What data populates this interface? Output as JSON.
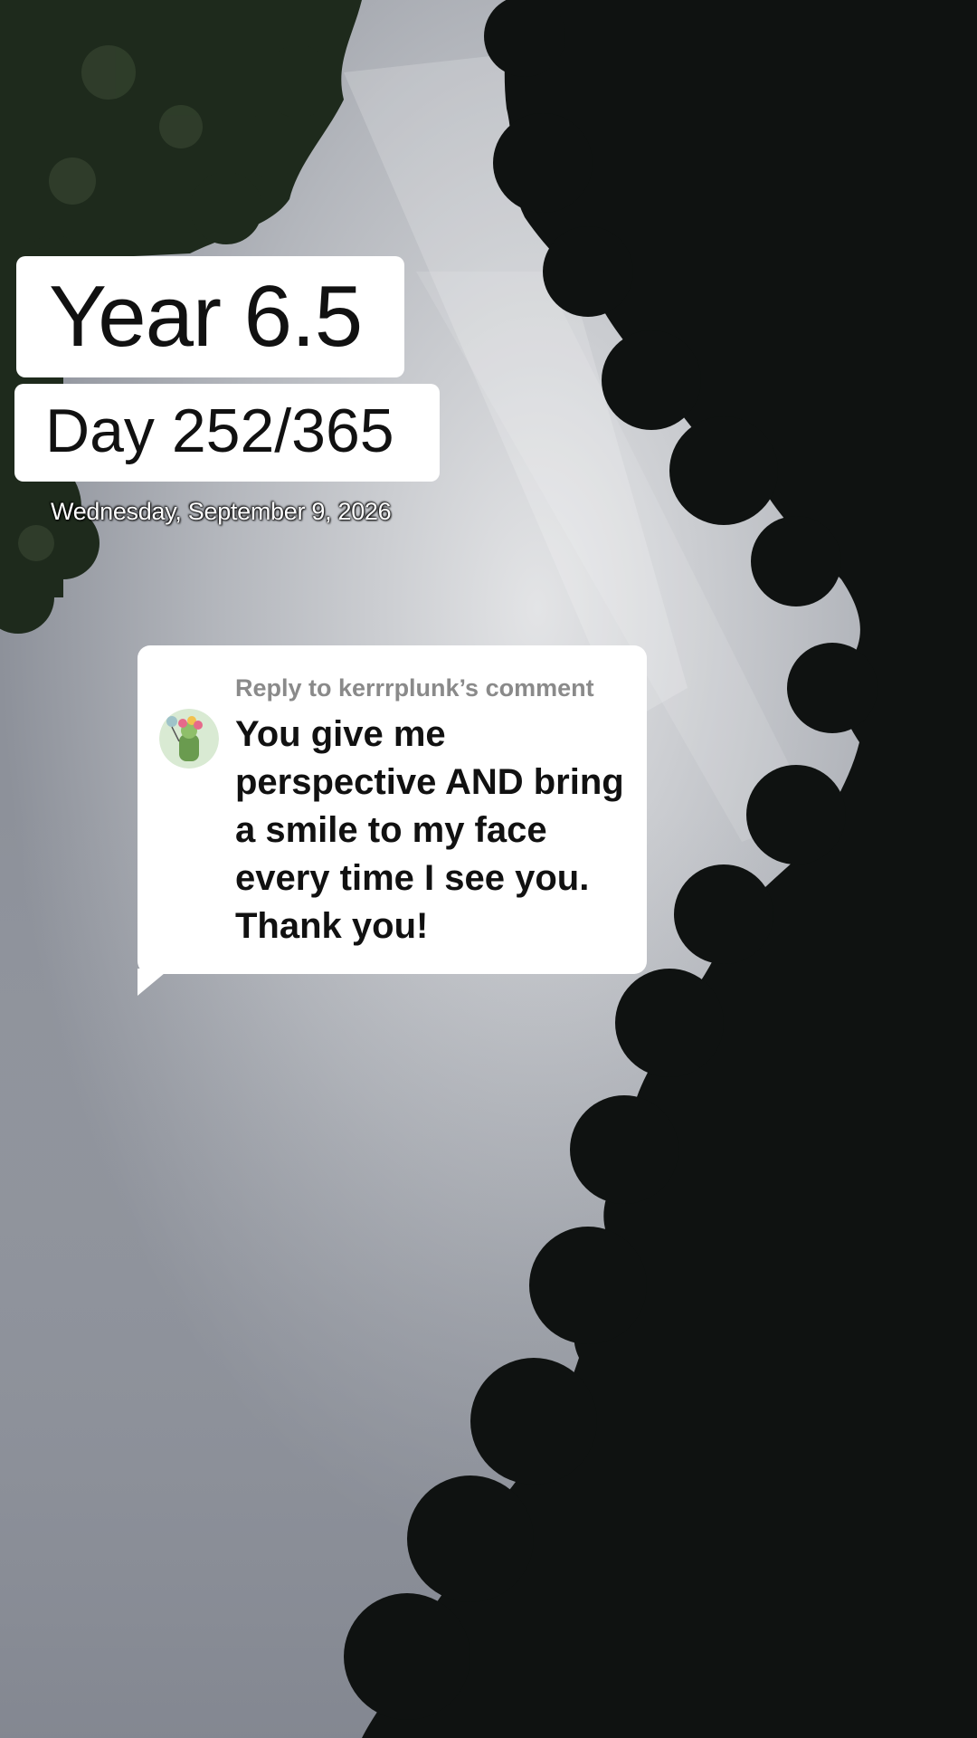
{
  "overlay": {
    "year_label": "Year 6.5",
    "day_label": "Day 252/365",
    "date_label": "Wednesday, September 9, 2026"
  },
  "reply": {
    "header": "Reply to kerrrplunk’s comment",
    "body": "You give me perspective AND bring a smile to my face every time I see you. Thank you!",
    "avatar_icon": "commenter-avatar-icon"
  },
  "colors": {
    "sky": "#b8bbc1",
    "foliage": "#111413",
    "card_bg": "#ffffff",
    "header_text": "#8a8a8a",
    "body_text": "#111111"
  }
}
